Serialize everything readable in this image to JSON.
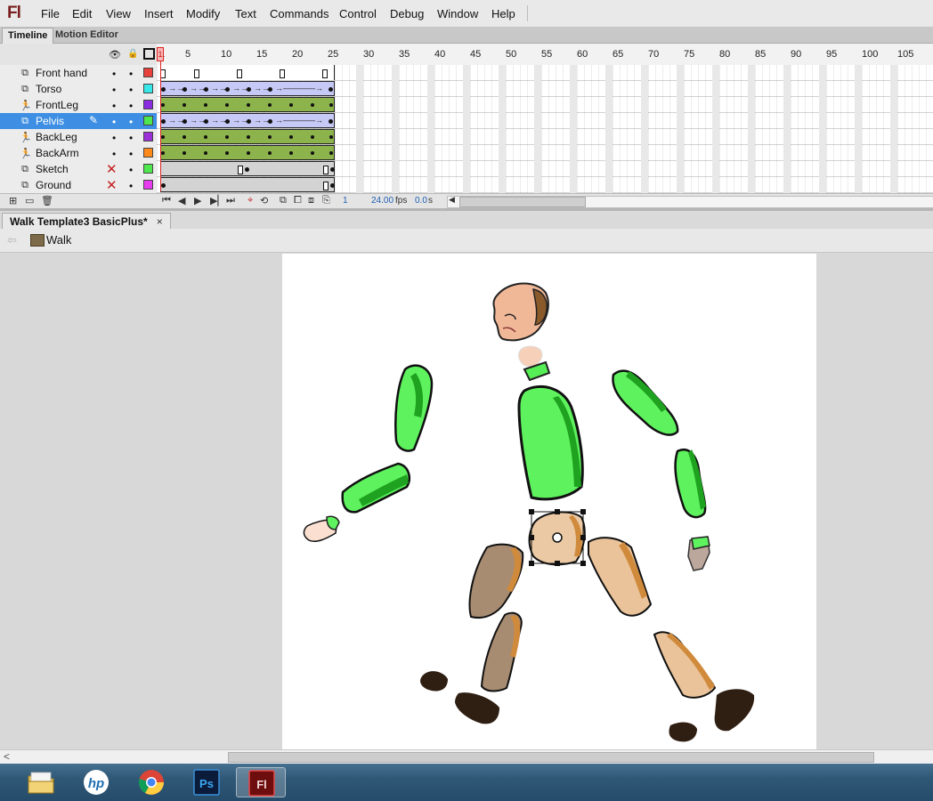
{
  "app": {
    "logo": "Fl"
  },
  "menu": [
    "File",
    "Edit",
    "View",
    "Insert",
    "Modify",
    "Text",
    "Commands",
    "Control",
    "Debug",
    "Window",
    "Help"
  ],
  "panel_tabs": {
    "timeline": "Timeline",
    "motion_editor": "Motion Editor"
  },
  "timeline": {
    "ruler_labels": [
      "1",
      "5",
      "10",
      "15",
      "20",
      "25",
      "30",
      "35",
      "40",
      "45",
      "50",
      "55",
      "60",
      "65",
      "70",
      "75",
      "80",
      "85",
      "90",
      "95",
      "100",
      "105"
    ],
    "layers": [
      {
        "name": "Front hand",
        "icon": "layer-icon",
        "visible": true,
        "swatch": "#e8403a"
      },
      {
        "name": "Torso",
        "icon": "layer-icon",
        "visible": true,
        "swatch": "#36e8e8"
      },
      {
        "name": "FrontLeg",
        "icon": "armature-icon",
        "visible": true,
        "swatch": "#8a2be2"
      },
      {
        "name": "Pelvis",
        "icon": "layer-icon",
        "visible": true,
        "swatch": "#4ee84e",
        "selected": true
      },
      {
        "name": "BackLeg",
        "icon": "armature-icon",
        "visible": true,
        "swatch": "#9b30d9"
      },
      {
        "name": "BackArm",
        "icon": "armature-icon",
        "visible": true,
        "swatch": "#ff8a1a"
      },
      {
        "name": "Sketch",
        "icon": "layer-icon",
        "visible": false,
        "swatch": "#4ee84e"
      },
      {
        "name": "Ground",
        "icon": "layer-icon",
        "visible": false,
        "swatch": "#e83aee"
      }
    ],
    "current_frame": "1",
    "fps": "24.00",
    "fps_unit": "fps",
    "elapsed": "0.0",
    "elapsed_unit": "s"
  },
  "document": {
    "tab_title": "Walk Template3 BasicPlus*",
    "close_glyph": "×"
  },
  "editbar": {
    "scene": "Walk"
  },
  "colors": {
    "accent": "#3e8fe3",
    "flash_red": "#7a1f1f",
    "tween_blue": "#c6c8f6",
    "tween_green": "#8db34c"
  }
}
